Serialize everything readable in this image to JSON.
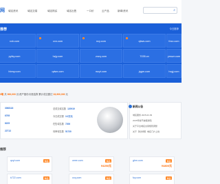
{
  "logo_fragment": "网",
  "nav": [
    "域名资讯",
    "域名交易",
    "域名购买",
    "域名出售",
    "一口价",
    "云产品",
    "新闻/资讯"
  ],
  "search_placeholder": "",
  "hero": {
    "title": "推荐",
    "more": "今日推荐",
    "tiles": [
      "xxb.com",
      "cxn.com",
      "ncy.com",
      "qbws.com",
      "thxz.com",
      "pyfxy.com",
      "hzjy.com",
      "zxzq.com",
      "7035.cn",
      "ymuzr.com",
      "hbmy.com",
      "qdwx.com",
      "mzyt.com",
      "jqgm.com",
      "hcgj.com"
    ]
  },
  "ticker": {
    "pre": "0笔",
    "mid1": "共",
    "amount1": "900,000",
    "mid2": "元/资产股份月底结算",
    "mid3": "累计成交额达",
    "amount2": "33,900,000",
    "post": "元"
  },
  "stats": [
    {
      "label": "",
      "value": "3068118"
    },
    {
      "label": "",
      "value": "6795"
    },
    {
      "label": "",
      "value": "8225"
    },
    {
      "label": "",
      "value": "22713"
    },
    {
      "label": "总成交域名数",
      "value": "120919"
    },
    {
      "label": "今日成交额",
      "value": "3.0万元"
    },
    {
      "label": "在售域名数",
      "value": "7206"
    },
    {
      "label": "待审域名数",
      "value": "51730"
    }
  ],
  "news": {
    "title": "新闻公告",
    "items": [
      "域名服务 2025-02-09",
      "2025年春节放假通知",
      "关于平台域名交易规则调整",
      "关于【优米网】域名门户上线"
    ]
  },
  "recommend": {
    "title": "推荐",
    "cards": [
      {
        "domain": "qxyl.com",
        "tag": "精品",
        "price": "",
        "desc": ""
      },
      {
        "domain": "ceee.com",
        "tag": "精品",
        "price": "¥4250元",
        "desc": ""
      },
      {
        "domain": "ghm.com",
        "tag": "精品",
        "price": "¥4800元",
        "desc": ""
      },
      {
        "domain": "k722.com",
        "tag": "精品",
        "price": "",
        "desc": ""
      },
      {
        "domain": "ccq.com",
        "tag": "精品",
        "price": "",
        "desc": ""
      },
      {
        "domain": "fzy.com",
        "tag": "精品",
        "price": "¥4250元",
        "desc": ""
      }
    ]
  }
}
